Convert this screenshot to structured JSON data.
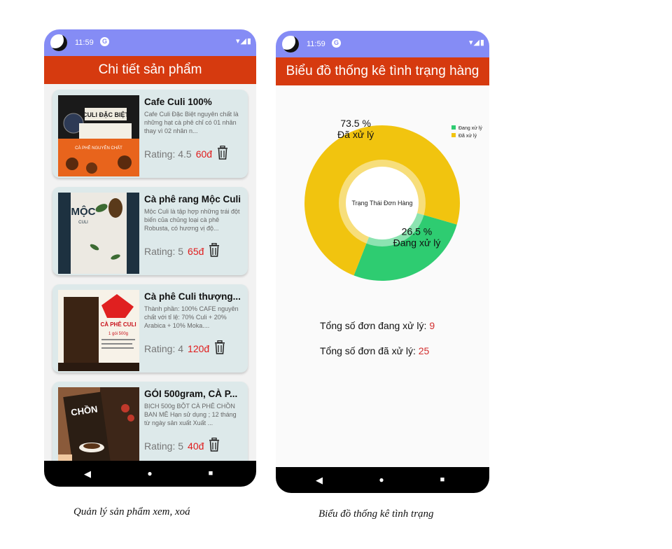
{
  "screen1": {
    "status_time": "11:59",
    "title": "Chi tiết sản phẩm",
    "products": [
      {
        "name": "Cafe Culi 100%",
        "description": "Cafe Culi Đặc Biệt nguyên chất là những hạt cà phê chỉ có 01 nhân thay vì 02 nhân n...",
        "rating": "Rating: 4.5",
        "price": "60đ"
      },
      {
        "name": "Cà phê rang Mộc Culi",
        "description": "Mộc Culi là tập hợp những trái đột biến của chủng loại cà phê Robusta, có hương vị độ...",
        "rating": "Rating: 5",
        "price": "65đ"
      },
      {
        "name": "Cà phê Culi thượng...",
        "description": "Thành phần: 100% CAFE nguyên chất với tỉ lệ: 70% Culi + 20% Arabica + 10% Moka....",
        "rating": "Rating: 4",
        "price": "120đ"
      },
      {
        "name": "GÓI 500gram, CÀ P...",
        "description": "BỊCH 500g BỘT CÀ PHÊ CHỒN BAN MÊ   Hạn sử dụng ; 12 tháng từ ngày sản xuất  Xuất ...",
        "rating": "Rating: 5",
        "price": "40đ"
      }
    ],
    "thumb_text": {
      "p1_brand": "CULI ĐẶC BIỆT",
      "p1_sub": "CÀ PHÊ NGUYÊN CHẤT",
      "p2_brand": "MỘC",
      "p2_sub": "CULI",
      "p3_brand": "CÀ PHÊ CULI",
      "p3_sub": "1 gói 500g",
      "p4_brand": "CHỒN"
    }
  },
  "screen2": {
    "status_time": "11:59",
    "title": "Biểu đồ thống kê tình trạng hàng",
    "totals": [
      {
        "label": "Tổng số đơn đang xử lý: ",
        "value": "9"
      },
      {
        "label": "Tổng số đơn đã xử lý: ",
        "value": "25"
      }
    ]
  },
  "chart_data": {
    "type": "pie",
    "title": "",
    "center_text": "Trạng Thái Đơn Hàng",
    "legend_position": "top-right",
    "slices": [
      {
        "label": "Đang xử lý",
        "value": 26.5,
        "count": 9,
        "color": "#2ecc71",
        "value_label": "26.5 %"
      },
      {
        "label": "Đã xử lý",
        "value": 73.5,
        "count": 25,
        "color": "#f1c40f",
        "value_label": "73.5 %"
      }
    ]
  },
  "captions": {
    "left": "Quản lý sản phẩm xem, xoá",
    "right": "Biểu đồ thống kê tình trạng"
  }
}
